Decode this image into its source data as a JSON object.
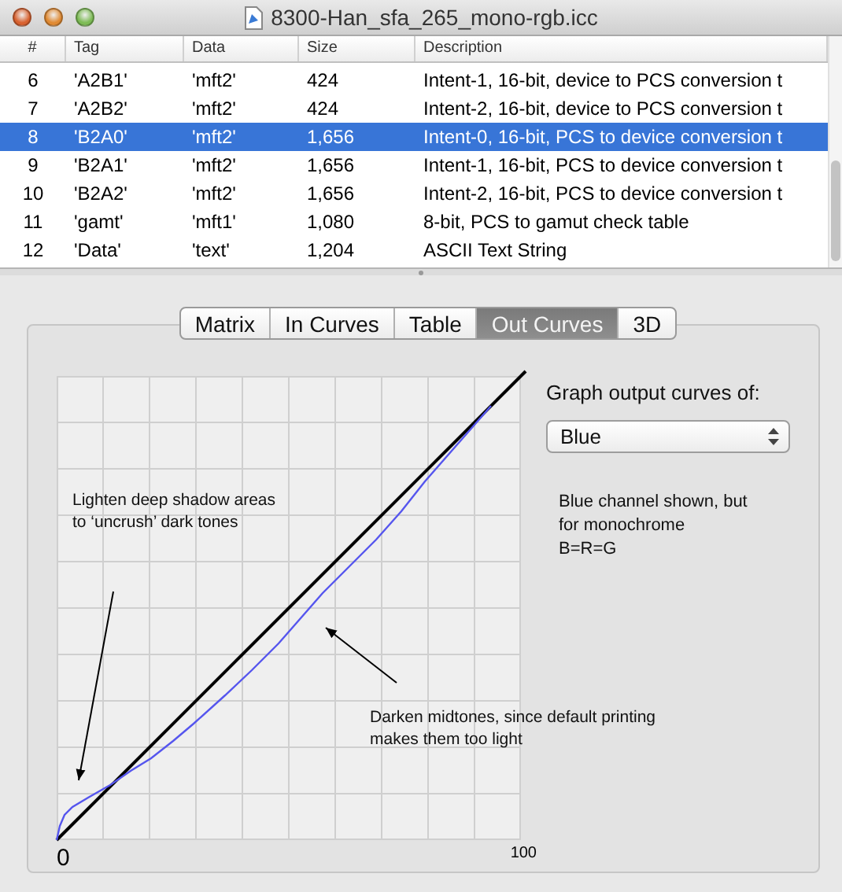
{
  "window": {
    "title": "8300-Han_sfa_265_mono-rgb.icc"
  },
  "table": {
    "columns": [
      "#",
      "Tag",
      "Data",
      "Size",
      "Description"
    ],
    "rows": [
      {
        "cells": [
          "6",
          "'A2B1'",
          "'mft2'",
          "424",
          "Intent-1, 16-bit, device to PCS conversion t"
        ],
        "selected": false
      },
      {
        "cells": [
          "7",
          "'A2B2'",
          "'mft2'",
          "424",
          "Intent-2, 16-bit, device to PCS conversion t"
        ],
        "selected": false
      },
      {
        "cells": [
          "8",
          "'B2A0'",
          "'mft2'",
          "1,656",
          "Intent-0, 16-bit, PCS to device conversion t"
        ],
        "selected": true
      },
      {
        "cells": [
          "9",
          "'B2A1'",
          "'mft2'",
          "1,656",
          "Intent-1, 16-bit, PCS to device conversion t"
        ],
        "selected": false
      },
      {
        "cells": [
          "10",
          "'B2A2'",
          "'mft2'",
          "1,656",
          "Intent-2, 16-bit, PCS to device conversion t"
        ],
        "selected": false
      },
      {
        "cells": [
          "11",
          "'gamt'",
          "'mft1'",
          "1,080",
          "8-bit, PCS to gamut check table"
        ],
        "selected": false
      },
      {
        "cells": [
          "12",
          "'Data'",
          "'text'",
          "1,204",
          "ASCII Text String"
        ],
        "selected": false
      }
    ]
  },
  "tabs": [
    {
      "label": "Matrix",
      "selected": false
    },
    {
      "label": "In Curves",
      "selected": false
    },
    {
      "label": "Table",
      "selected": false
    },
    {
      "label": "Out Curves",
      "selected": true
    },
    {
      "label": "3D",
      "selected": false
    }
  ],
  "graph": {
    "annotations": [
      {
        "lines": [
          "Lighten deep shadow areas",
          "to ‘uncrush’ dark tones"
        ]
      },
      {
        "lines": [
          "Darken midtones, since default printing",
          "makes them too light"
        ]
      }
    ],
    "x_axis_labels": [
      "0",
      "100"
    ]
  },
  "controls": {
    "label": "Graph output curves of:",
    "popup": {
      "value": "Blue"
    },
    "note_lines": [
      "Blue channel shown, but",
      "for monochrome",
      "B=R=G"
    ]
  }
}
